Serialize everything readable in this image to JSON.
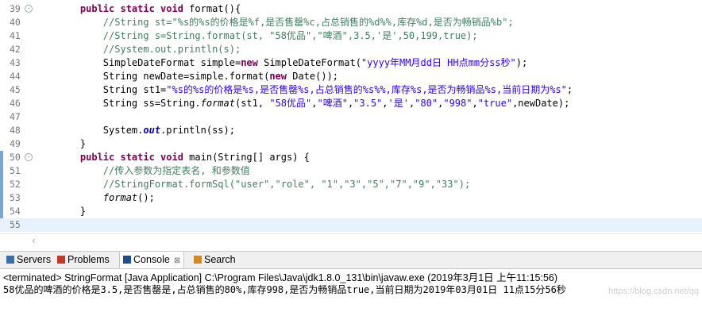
{
  "editor": {
    "lines": [
      {
        "num": "39",
        "fold": "-",
        "parts": [
          [
            "",
            "    "
          ],
          [
            "kw",
            "public static void"
          ],
          [
            "",
            " format(){"
          ]
        ]
      },
      {
        "num": "40",
        "parts": [
          [
            "",
            "        "
          ],
          [
            "cm",
            "//String st=\"%s的%s的价格是%f,是否售罄%c,占总销售的%d%%,库存%d,是否为畅销品%b\";"
          ]
        ]
      },
      {
        "num": "41",
        "parts": [
          [
            "",
            "        "
          ],
          [
            "cm",
            "//String s=String.format(st, \"58优品\",\"啤酒\",3.5,'是',50,199,true);"
          ]
        ]
      },
      {
        "num": "42",
        "parts": [
          [
            "",
            "        "
          ],
          [
            "cm",
            "//System.out.println(s);"
          ]
        ]
      },
      {
        "num": "43",
        "parts": [
          [
            "",
            "        SimpleDateFormat simple="
          ],
          [
            "kw",
            "new"
          ],
          [
            "",
            " SimpleDateFormat("
          ],
          [
            "str",
            "\"yyyy年MM月dd日 HH点mm分ss秒\""
          ],
          [
            "",
            ");"
          ]
        ]
      },
      {
        "num": "44",
        "parts": [
          [
            "",
            "        String newDate=simple.format("
          ],
          [
            "kw",
            "new"
          ],
          [
            "",
            " Date());"
          ]
        ]
      },
      {
        "num": "45",
        "parts": [
          [
            "",
            "        String st1="
          ],
          [
            "str",
            "\"%s的%s的价格是%s,是否售罄%s,占总销售的%s%%,库存%s,是否为畅销品%s,当前日期为%s\""
          ],
          [
            "",
            ";"
          ]
        ]
      },
      {
        "num": "46",
        "parts": [
          [
            "",
            "        String ss=String."
          ],
          [
            "it",
            "format"
          ],
          [
            "",
            "(st1, "
          ],
          [
            "str",
            "\"58优品\""
          ],
          [
            "",
            ","
          ],
          [
            "str",
            "\"啤酒\""
          ],
          [
            "",
            ","
          ],
          [
            "str",
            "\"3.5\""
          ],
          [
            "",
            ","
          ],
          [
            "str",
            "'是'"
          ],
          [
            "",
            ","
          ],
          [
            "str",
            "\"80\""
          ],
          [
            "",
            ","
          ],
          [
            "str",
            "\"998\""
          ],
          [
            "",
            ","
          ],
          [
            "str",
            "\"true\""
          ],
          [
            "",
            ",newDate);"
          ]
        ]
      },
      {
        "num": "47",
        "parts": [
          [
            "",
            ""
          ]
        ]
      },
      {
        "num": "48",
        "parts": [
          [
            "",
            "        System."
          ],
          [
            "fld",
            "out"
          ],
          [
            "",
            ".println(ss);"
          ]
        ]
      },
      {
        "num": "49",
        "parts": [
          [
            "",
            "    }"
          ]
        ]
      },
      {
        "num": "50",
        "fold": "-",
        "mark": true,
        "parts": [
          [
            "",
            "    "
          ],
          [
            "kw",
            "public static void"
          ],
          [
            "",
            " main(String[] args) {"
          ]
        ]
      },
      {
        "num": "51",
        "mark": true,
        "parts": [
          [
            "",
            "        "
          ],
          [
            "cm",
            "//传入参数为指定表名, 和参数值"
          ]
        ]
      },
      {
        "num": "52",
        "mark": true,
        "parts": [
          [
            "",
            "        "
          ],
          [
            "cm",
            "//StringFormat.formSql(\"user\",\"role\", \"1\",\"3\",\"5\",\"7\",\"9\",\"33\");"
          ]
        ]
      },
      {
        "num": "53",
        "mark": true,
        "parts": [
          [
            "",
            "        "
          ],
          [
            "it",
            "format"
          ],
          [
            "",
            "();"
          ]
        ]
      },
      {
        "num": "54",
        "mark": true,
        "parts": [
          [
            "",
            "    }"
          ]
        ]
      },
      {
        "num": "55",
        "current": true,
        "parts": [
          [
            "",
            ""
          ]
        ]
      }
    ],
    "scroll_left_glyph": "‹"
  },
  "views": {
    "tabs": [
      {
        "label": "Servers",
        "icon": "servers-icon",
        "color": "#3a6ea5"
      },
      {
        "label": "Problems",
        "icon": "problems-icon",
        "color": "#c0392b"
      },
      {
        "label": "Console",
        "icon": "console-icon",
        "color": "#1f4e8c",
        "active": true,
        "close": "⊠"
      },
      {
        "label": "Search",
        "icon": "search-icon",
        "color": "#d48a1e"
      }
    ]
  },
  "console": {
    "header": "<terminated> StringFormat [Java Application] C:\\Program Files\\Java\\jdk1.8.0_131\\bin\\javaw.exe (2019年3月1日 上午11:15:56)",
    "output": "58优品的啤酒的价格是3.5,是否售罄是,占总销售的80%,库存998,是否为畅销品true,当前日期为2019年03月01日 11点15分56秒"
  },
  "watermark": "https://blog.csdn.net/qq"
}
